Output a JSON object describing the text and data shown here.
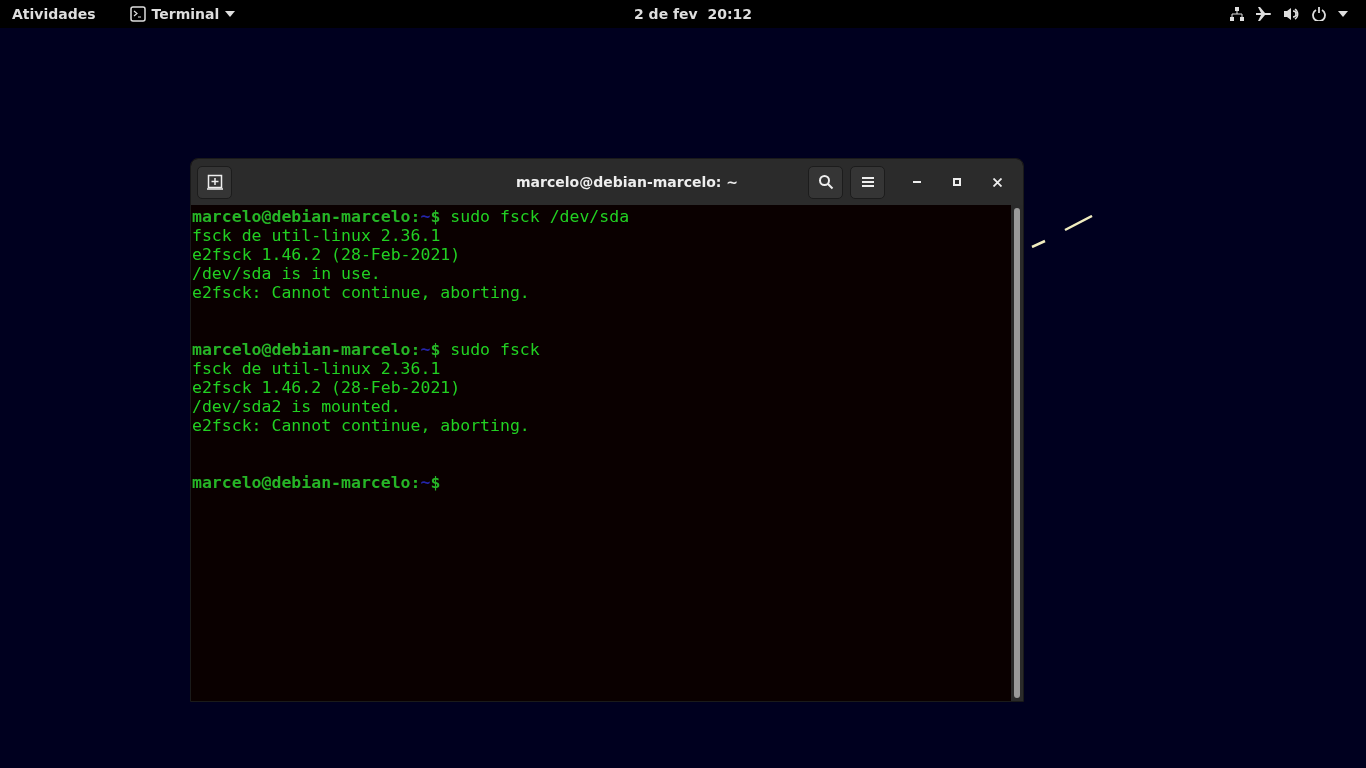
{
  "top_bar": {
    "activities": "Atividades",
    "app_menu": "Terminal",
    "clock": "2 de fev  20:12"
  },
  "window": {
    "title": "marcelo@debian-marcelo: ~"
  },
  "terminal": {
    "lines": [
      {
        "kind": "prompt",
        "user_host": "marcelo@debian-marcelo",
        "separator": ":",
        "path": "~",
        "symbol": "$",
        "command": " sudo fsck /dev/sda"
      },
      {
        "kind": "output",
        "text": "fsck de util-linux 2.36.1"
      },
      {
        "kind": "output",
        "text": "e2fsck 1.46.2 (28-Feb-2021)"
      },
      {
        "kind": "output",
        "text": "/dev/sda is in use."
      },
      {
        "kind": "output",
        "text": "e2fsck: Cannot continue, aborting."
      },
      {
        "kind": "blank"
      },
      {
        "kind": "blank"
      },
      {
        "kind": "prompt",
        "user_host": "marcelo@debian-marcelo",
        "separator": ":",
        "path": "~",
        "symbol": "$",
        "command": " sudo fsck"
      },
      {
        "kind": "output",
        "text": "fsck de util-linux 2.36.1"
      },
      {
        "kind": "output",
        "text": "e2fsck 1.46.2 (28-Feb-2021)"
      },
      {
        "kind": "output",
        "text": "/dev/sda2 is mounted."
      },
      {
        "kind": "output",
        "text": "e2fsck: Cannot continue, aborting."
      },
      {
        "kind": "blank"
      },
      {
        "kind": "blank"
      },
      {
        "kind": "prompt",
        "user_host": "marcelo@debian-marcelo",
        "separator": ":",
        "path": "~",
        "symbol": "$"
      }
    ]
  }
}
